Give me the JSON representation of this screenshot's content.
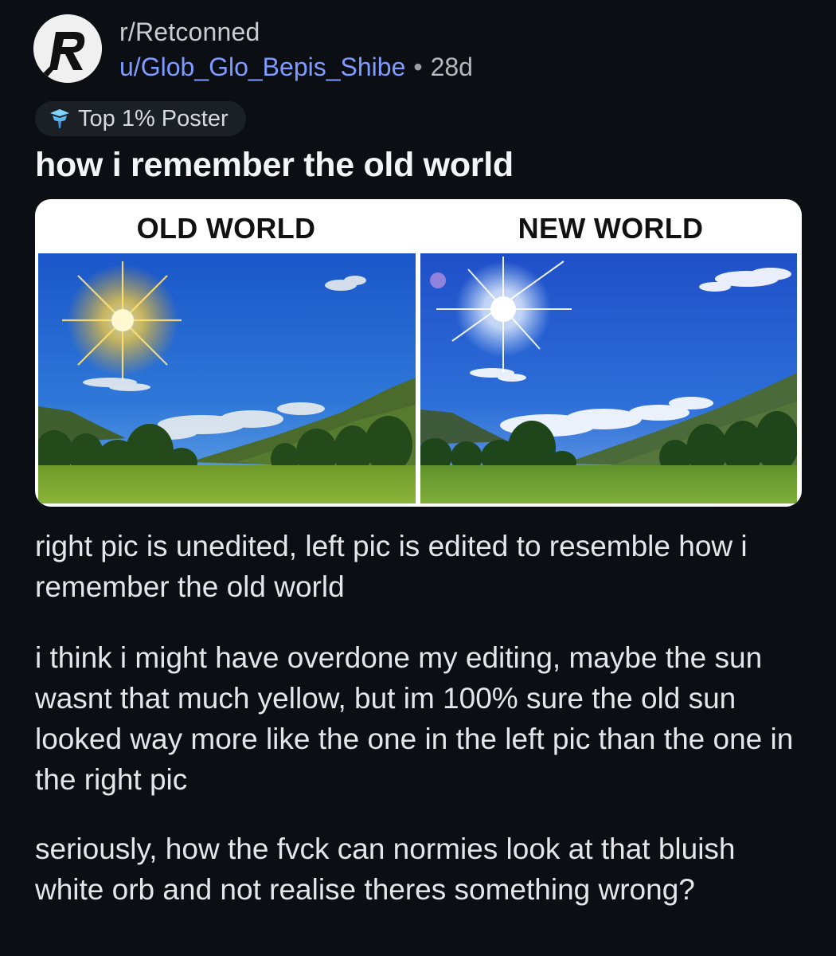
{
  "post": {
    "subreddit": "r/Retconned",
    "username": "u/Glob_Glo_Bepis_Shibe",
    "separator": "•",
    "age": "28d",
    "badge": "Top 1% Poster",
    "title": "how i remember the old world"
  },
  "image": {
    "left_label": "OLD WORLD",
    "right_label": "NEW WORLD"
  },
  "body": {
    "paragraph_1": "right pic is unedited, left pic is edited to resemble how i remember the old world",
    "paragraph_2": "i think i might have overdone my editing, maybe the sun wasnt that much yellow, but im 100% sure the old sun looked way more like the one in the left pic than the one in the right pic",
    "paragraph_3": "seriously, how the fvck can normies look at that bluish white orb and not realise theres something wrong?"
  },
  "icons": {
    "avatar": "reddit-avatar-R",
    "badge": "top-poster-badge-icon"
  }
}
